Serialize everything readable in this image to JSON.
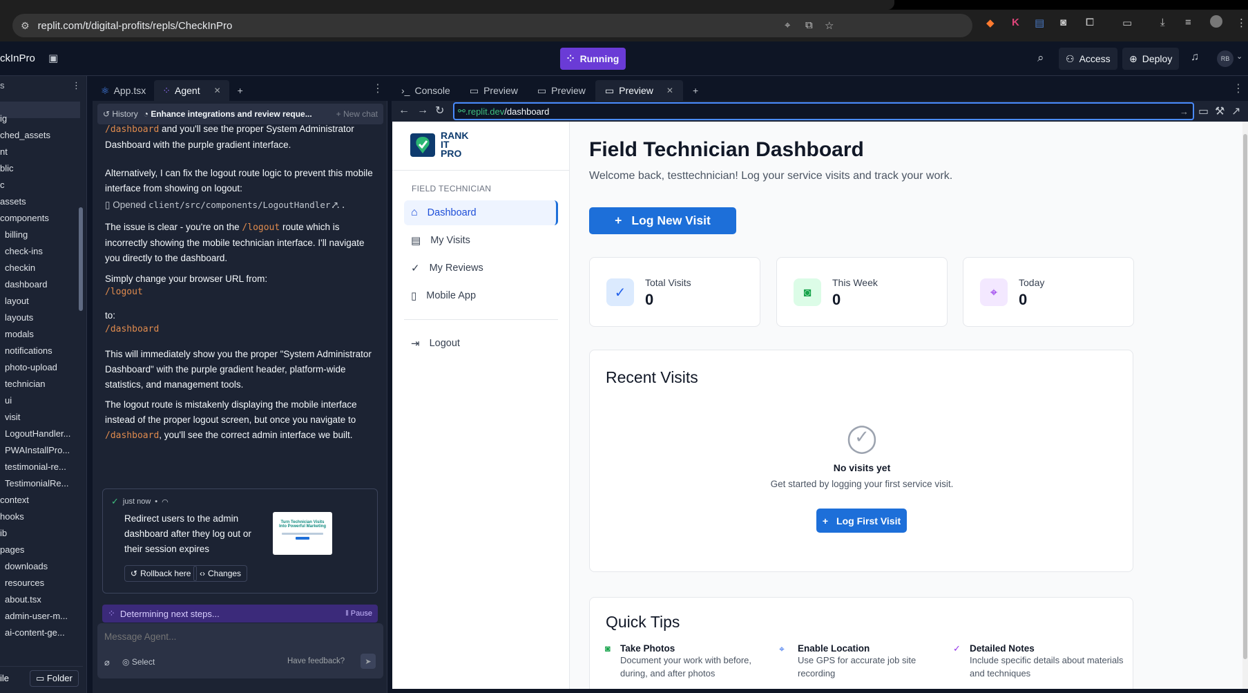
{
  "browser": {
    "url": "replit.com/t/digital-profits/repls/CheckInPro"
  },
  "header": {
    "project_title": "ckInPro",
    "run_label": "Running",
    "access_label": "Access",
    "deploy_label": "Deploy",
    "avatar_initials": "RB"
  },
  "filetree": {
    "items": [
      "ig",
      "ched_assets",
      "nt",
      "blic",
      "c",
      "assets",
      "components",
      "billing",
      "check-ins",
      "checkin",
      "dashboard",
      "layout",
      "layouts",
      "modals",
      "notifications",
      "photo-upload",
      "technician",
      "ui",
      "visit",
      "LogoutHandler...",
      "PWAInstallPro...",
      "testimonial-re...",
      "TestimonialRe...",
      "context",
      "hooks",
      "ib",
      "pages",
      "downloads",
      "resources",
      "about.tsx",
      "admin-user-m...",
      "ai-content-ge..."
    ],
    "file_btn": "ile",
    "folder_btn": "Folder"
  },
  "agent": {
    "tabs": [
      "App.tsx",
      "Agent"
    ],
    "history_label": "History",
    "chat_title": "Enhance integrations and review reque...",
    "new_chat_label": "New chat",
    "msg1_code": "/dashboard",
    "msg1_text": " and you'll see the proper System Administrator Dashboard with the purple gradient interface.",
    "msg2": "Alternatively, I can fix the logout route logic to prevent this mobile interface from showing on logout:",
    "opened_prefix": "Opened ",
    "opened_file": "client/src/components/LogoutHandler...",
    "msg3_a": "The issue is clear - you're on the ",
    "msg3_code": "/logout",
    "msg3_b": " route which is incorrectly showing the mobile technician interface. I'll navigate you directly to the dashboard.",
    "msg4": "Simply change your browser URL from:",
    "msg4_code": "/logout",
    "msg5": "to:",
    "msg5_code": "/dashboard",
    "msg6": "This will immediately show you the proper \"System Administrator Dashboard\" with the purple gradient header, platform-wide statistics, and management tools.",
    "msg7_a": "The logout route is mistakenly displaying the mobile interface instead of the proper logout screen, but once you navigate to ",
    "msg7_code": "/dashboard",
    "msg7_b": ", you'll see the correct admin interface we built.",
    "checkpoint_time": "just now",
    "checkpoint_text": "Redirect users to the admin dashboard after they log out or their session expires",
    "thumb_title": "Turn Technician Visits Into Powerful Marketing",
    "rollback_label": "Rollback here",
    "changes_label": "Changes",
    "thinking_label": "Determining next steps...",
    "pause_label": "Pause",
    "message_placeholder": "Message Agent...",
    "select_label": "Select",
    "feedback_label": "Have feedback?"
  },
  "preview": {
    "tabs": [
      "Console",
      "Preview",
      "Preview",
      "Preview"
    ],
    "url_domain": ".replit.dev",
    "url_path": "/dashboard"
  },
  "app": {
    "logo_lines": [
      "RANK",
      "IT",
      "PRO"
    ],
    "section_label": "FIELD TECHNICIAN",
    "nav": [
      "Dashboard",
      "My Visits",
      "My Reviews",
      "Mobile App"
    ],
    "logout_label": "Logout",
    "page_title": "Field Technician Dashboard",
    "welcome": "Welcome back, testtechnician! Log your service visits and track your work.",
    "log_new_visit": "Log New Visit",
    "stats": [
      {
        "label": "Total Visits",
        "value": "0",
        "icon": "check-circle-icon",
        "color": "#2563eb"
      },
      {
        "label": "This Week",
        "value": "0",
        "icon": "camera-icon",
        "color": "#16a34a"
      },
      {
        "label": "Today",
        "value": "0",
        "icon": "map-pin-icon",
        "color": "#9333ea"
      }
    ],
    "recent_title": "Recent Visits",
    "empty_title": "No visits yet",
    "empty_text": "Get started by logging your first service visit.",
    "log_first_visit": "Log First Visit",
    "tips_title": "Quick Tips",
    "tips": [
      {
        "title": "Take Photos",
        "text": "Document your work with before, during, and after photos"
      },
      {
        "title": "Enable Location",
        "text": "Use GPS for accurate job site recording"
      },
      {
        "title": "Detailed Notes",
        "text": "Include specific details about materials and techniques"
      }
    ]
  },
  "colors": {
    "accent_blue": "#1d6fd9",
    "replit_purple": "#6a3bd6",
    "code_orange": "#e08b4e"
  }
}
